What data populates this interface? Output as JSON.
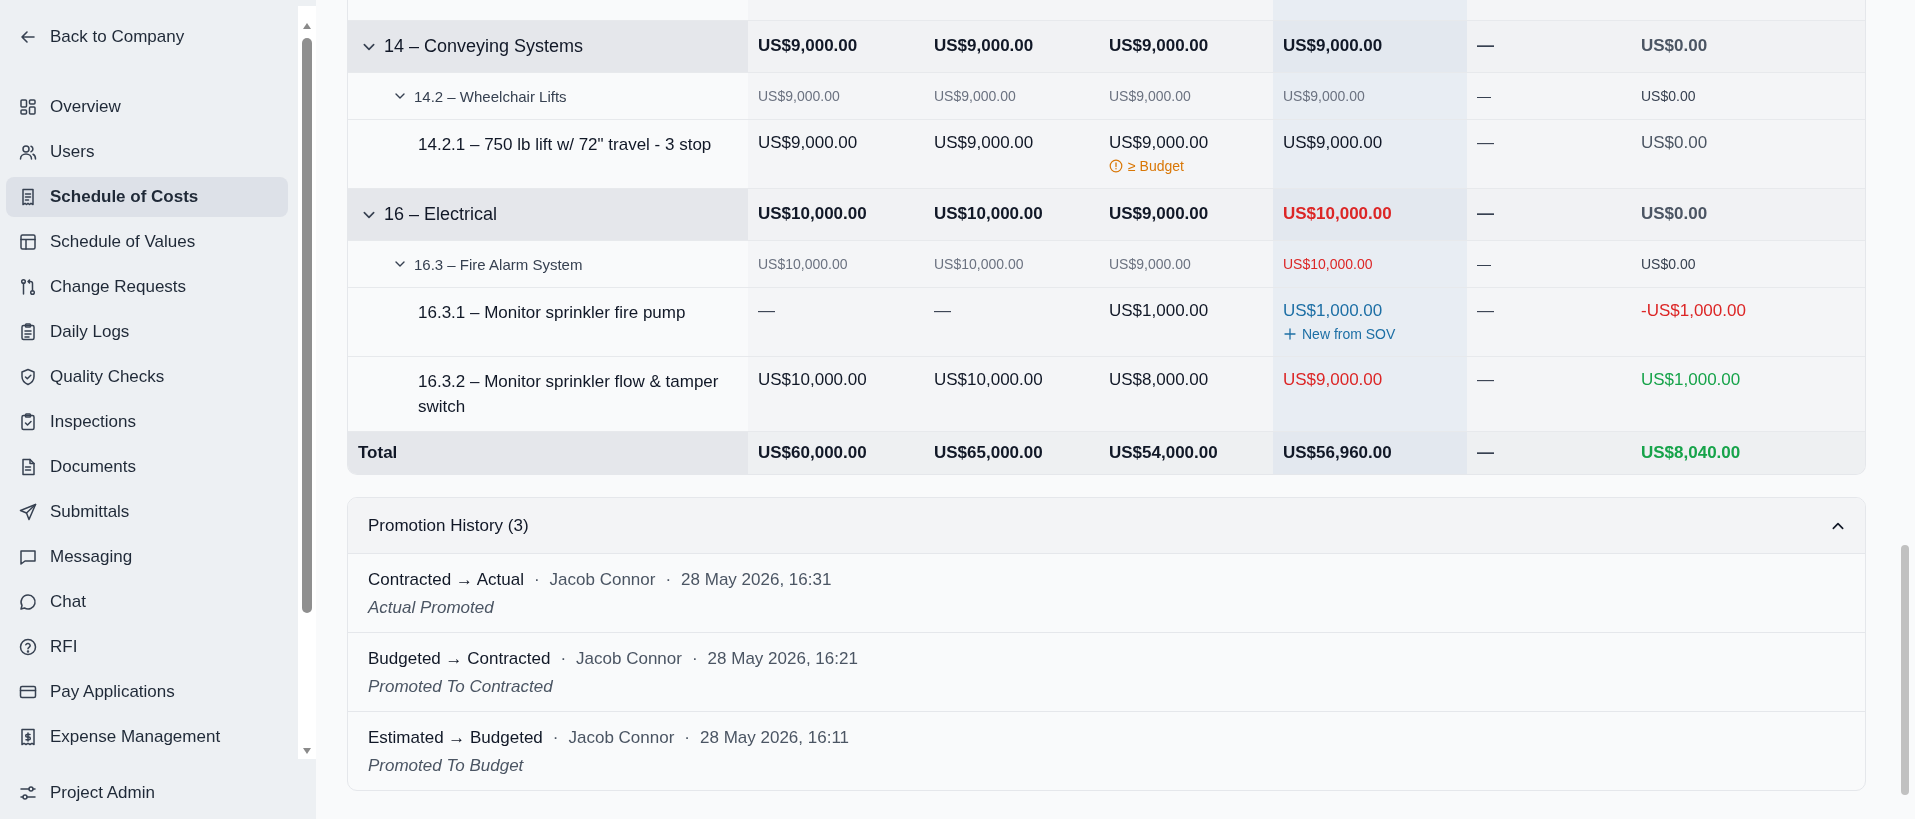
{
  "sidebar": {
    "back": {
      "label": "Back to Company"
    },
    "items": [
      {
        "label": "Overview",
        "selected": false
      },
      {
        "label": "Users",
        "selected": false
      },
      {
        "label": "Schedule of Costs",
        "selected": true
      },
      {
        "label": "Schedule of Values",
        "selected": false
      },
      {
        "label": "Change Requests",
        "selected": false
      },
      {
        "label": "Daily Logs",
        "selected": false
      },
      {
        "label": "Quality Checks",
        "selected": false
      },
      {
        "label": "Inspections",
        "selected": false
      },
      {
        "label": "Documents",
        "selected": false
      },
      {
        "label": "Submittals",
        "selected": false
      },
      {
        "label": "Messaging",
        "selected": false
      },
      {
        "label": "Chat",
        "selected": false
      },
      {
        "label": "RFI",
        "selected": false
      },
      {
        "label": "Pay Applications",
        "selected": false
      },
      {
        "label": "Expense Management",
        "selected": false
      }
    ],
    "footer": {
      "label": "Project Admin"
    }
  },
  "table": {
    "rows": [
      {
        "kind": "group",
        "expanded": true,
        "name": "14 – Conveying Systems",
        "cells": [
          {
            "text": "US$9,000.00",
            "color": "#111827"
          },
          {
            "text": "US$9,000.00",
            "color": "#111827"
          },
          {
            "text": "US$9,000.00",
            "color": "#111827"
          },
          {
            "text": "US$9,000.00",
            "color": "#111827"
          },
          {
            "text": "—",
            "color": "#374151"
          },
          {
            "text": "US$0.00",
            "color": "#4b5563"
          }
        ]
      },
      {
        "kind": "subgroup",
        "expanded": true,
        "name": "14.2 – Wheelchair Lifts",
        "cells": [
          {
            "text": "US$9,000.00",
            "color": "#6b7280"
          },
          {
            "text": "US$9,000.00",
            "color": "#6b7280"
          },
          {
            "text": "US$9,000.00",
            "color": "#6b7280"
          },
          {
            "text": "US$9,000.00",
            "color": "#6b7280"
          },
          {
            "text": "—",
            "color": "#374151"
          },
          {
            "text": "US$0.00",
            "color": "#374151"
          }
        ]
      },
      {
        "kind": "item",
        "name": "14.2.1 – 750 lb lift w/ 72\" travel - 3 stop",
        "cells": [
          {
            "text": "US$9,000.00",
            "color": "#111827"
          },
          {
            "text": "US$9,000.00",
            "color": "#111827"
          },
          {
            "text": "US$9,000.00",
            "color": "#111827",
            "note": {
              "kind": "warning",
              "text": "≥ Budget"
            }
          },
          {
            "text": "US$9,000.00",
            "color": "#111827"
          },
          {
            "text": "—",
            "color": "#374151"
          },
          {
            "text": "US$0.00",
            "color": "#4b5563"
          }
        ]
      },
      {
        "kind": "group",
        "expanded": true,
        "name": "16 – Electrical",
        "cells": [
          {
            "text": "US$10,000.00",
            "color": "#111827"
          },
          {
            "text": "US$10,000.00",
            "color": "#111827"
          },
          {
            "text": "US$9,000.00",
            "color": "#111827"
          },
          {
            "text": "US$10,000.00",
            "color": "#dc2626"
          },
          {
            "text": "—",
            "color": "#374151"
          },
          {
            "text": "US$0.00",
            "color": "#4b5563"
          }
        ]
      },
      {
        "kind": "subgroup",
        "expanded": true,
        "name": "16.3 – Fire Alarm System",
        "cells": [
          {
            "text": "US$10,000.00",
            "color": "#6b7280"
          },
          {
            "text": "US$10,000.00",
            "color": "#6b7280"
          },
          {
            "text": "US$9,000.00",
            "color": "#6b7280"
          },
          {
            "text": "US$10,000.00",
            "color": "#dc2626"
          },
          {
            "text": "—",
            "color": "#374151"
          },
          {
            "text": "US$0.00",
            "color": "#374151"
          }
        ]
      },
      {
        "kind": "item",
        "name": "16.3.1 – Monitor sprinkler fire pump",
        "cells": [
          {
            "text": "—",
            "color": "#374151"
          },
          {
            "text": "—",
            "color": "#374151"
          },
          {
            "text": "US$1,000.00",
            "color": "#111827"
          },
          {
            "text": "US$1,000.00",
            "color": "#1d6fa5",
            "note": {
              "kind": "action",
              "text": "New from SOV"
            }
          },
          {
            "text": "—",
            "color": "#374151"
          },
          {
            "text": "-US$1,000.00",
            "color": "#dc2626"
          }
        ]
      },
      {
        "kind": "item",
        "name": "16.3.2 – Monitor sprinkler flow & tamper switch",
        "cells": [
          {
            "text": "US$10,000.00",
            "color": "#111827"
          },
          {
            "text": "US$10,000.00",
            "color": "#111827"
          },
          {
            "text": "US$8,000.00",
            "color": "#111827"
          },
          {
            "text": "US$9,000.00",
            "color": "#dc2626"
          },
          {
            "text": "—",
            "color": "#374151"
          },
          {
            "text": "US$1,000.00",
            "color": "#16a34a"
          }
        ]
      },
      {
        "kind": "total",
        "name": "Total",
        "cells": [
          {
            "text": "US$60,000.00",
            "color": "#111827"
          },
          {
            "text": "US$65,000.00",
            "color": "#111827"
          },
          {
            "text": "US$54,000.00",
            "color": "#111827"
          },
          {
            "text": "US$56,960.00",
            "color": "#111827"
          },
          {
            "text": "—",
            "color": "#374151"
          },
          {
            "text": "US$8,040.00",
            "color": "#16a34a"
          }
        ]
      }
    ]
  },
  "history": {
    "title": "Promotion History (3)",
    "expanded": true,
    "separator": "·",
    "entries": [
      {
        "transition": "Contracted → Actual",
        "user": "Jacob Connor",
        "time": "28 May 2026, 16:31",
        "note": "Actual Promoted"
      },
      {
        "transition": "Budgeted → Contracted",
        "user": "Jacob Connor",
        "time": "28 May 2026, 16:21",
        "note": "Promoted To Contracted"
      },
      {
        "transition": "Estimated → Budgeted",
        "user": "Jacob Connor",
        "time": "28 May 2026, 16:11",
        "note": "Promoted To Budget"
      }
    ]
  }
}
